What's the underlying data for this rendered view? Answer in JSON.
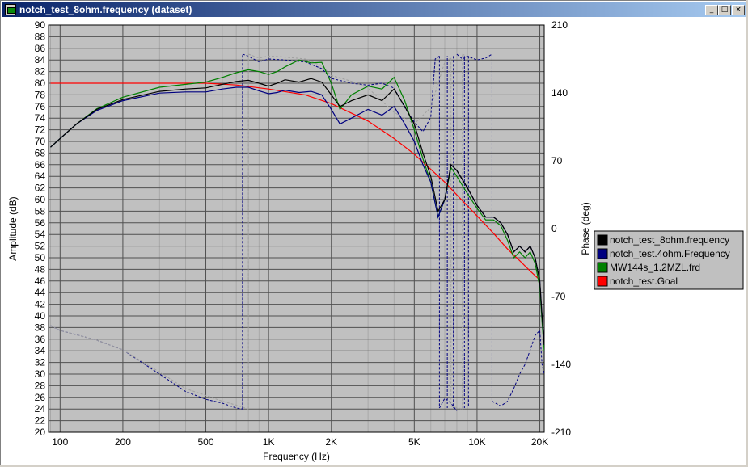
{
  "window": {
    "title": "notch_test_8ohm.frequency (dataset)",
    "controls": {
      "minimize": "_",
      "maximize": "□",
      "close": "×"
    }
  },
  "chart_data": {
    "type": "line",
    "xlabel": "Frequency (Hz)",
    "ylabel": "Amplitude (dB)",
    "y2label": "Phase (deg)",
    "xscale": "log",
    "xlim": [
      88,
      21000
    ],
    "ylim": [
      20,
      90
    ],
    "y2lim": [
      -210,
      210
    ],
    "grid": true,
    "legend_position": "right",
    "x_ticks": [
      {
        "value": 100,
        "label": "100"
      },
      {
        "value": 200,
        "label": "200"
      },
      {
        "value": 500,
        "label": "500"
      },
      {
        "value": 1000,
        "label": "1K"
      },
      {
        "value": 2000,
        "label": "2K"
      },
      {
        "value": 5000,
        "label": "5K"
      },
      {
        "value": 10000,
        "label": "10K"
      },
      {
        "value": 20000,
        "label": "20K"
      }
    ],
    "y_tick_labels": [
      "20",
      "22",
      "24",
      "26",
      "28",
      "30",
      "32",
      "34",
      "36",
      "38",
      "40",
      "42",
      "44",
      "46",
      "48",
      "50",
      "52",
      "54",
      "56",
      "58",
      "60",
      "62",
      "64",
      "66",
      "68",
      "70",
      "72",
      "74",
      "76",
      "78",
      "80",
      "82",
      "84",
      "86",
      "88",
      "90"
    ],
    "y2_ticks": [
      {
        "value": -210,
        "label": "-210"
      },
      {
        "value": -140,
        "label": "-140"
      },
      {
        "value": -70,
        "label": "-70"
      },
      {
        "value": 0,
        "label": "0"
      },
      {
        "value": 70,
        "label": "70"
      },
      {
        "value": 140,
        "label": "140"
      },
      {
        "value": 210,
        "label": "210"
      }
    ],
    "series": [
      {
        "name": "notch_test_8ohm.frequency",
        "color": "#000000",
        "axis": "amplitude",
        "points": [
          [
            90,
            69
          ],
          [
            100,
            70.5
          ],
          [
            120,
            73
          ],
          [
            150,
            75.5
          ],
          [
            200,
            77.2
          ],
          [
            300,
            78.6
          ],
          [
            400,
            79
          ],
          [
            500,
            79.2
          ],
          [
            600,
            79.8
          ],
          [
            700,
            80.3
          ],
          [
            800,
            80.5
          ],
          [
            900,
            80
          ],
          [
            1000,
            79.5
          ],
          [
            1100,
            80
          ],
          [
            1200,
            80.6
          ],
          [
            1400,
            80.2
          ],
          [
            1600,
            80.8
          ],
          [
            1800,
            80.2
          ],
          [
            2000,
            78
          ],
          [
            2200,
            76
          ],
          [
            2500,
            77
          ],
          [
            3000,
            78
          ],
          [
            3500,
            77
          ],
          [
            4000,
            79
          ],
          [
            4500,
            76
          ],
          [
            5000,
            73
          ],
          [
            5500,
            68
          ],
          [
            6000,
            64
          ],
          [
            6500,
            58
          ],
          [
            7000,
            60
          ],
          [
            7500,
            66
          ],
          [
            8000,
            65
          ],
          [
            9000,
            62
          ],
          [
            10000,
            59
          ],
          [
            11000,
            57
          ],
          [
            12000,
            57
          ],
          [
            13000,
            56
          ],
          [
            14000,
            54
          ],
          [
            15000,
            51
          ],
          [
            16000,
            52
          ],
          [
            17000,
            51
          ],
          [
            18000,
            52
          ],
          [
            19000,
            50
          ],
          [
            20000,
            46
          ],
          [
            20500,
            40
          ],
          [
            21000,
            35
          ]
        ]
      },
      {
        "name": "notch_test.4ohm.Frequency",
        "color": "#000080",
        "axis": "amplitude",
        "points": [
          [
            90,
            69
          ],
          [
            100,
            70.5
          ],
          [
            120,
            73
          ],
          [
            150,
            75.3
          ],
          [
            200,
            77
          ],
          [
            300,
            78.3
          ],
          [
            400,
            78.5
          ],
          [
            500,
            78.5
          ],
          [
            600,
            79
          ],
          [
            700,
            79.3
          ],
          [
            800,
            79.3
          ],
          [
            900,
            78.7
          ],
          [
            1000,
            78.2
          ],
          [
            1100,
            78.4
          ],
          [
            1200,
            78.8
          ],
          [
            1400,
            78.4
          ],
          [
            1600,
            78.6
          ],
          [
            1800,
            78
          ],
          [
            2000,
            75.5
          ],
          [
            2200,
            73
          ],
          [
            2500,
            74
          ],
          [
            3000,
            75.5
          ],
          [
            3500,
            74.5
          ],
          [
            4000,
            76
          ],
          [
            4500,
            73
          ],
          [
            5000,
            70
          ],
          [
            5500,
            66
          ],
          [
            6000,
            63
          ],
          [
            6500,
            57
          ],
          [
            7000,
            60
          ],
          [
            7500,
            66
          ],
          [
            8000,
            65
          ],
          [
            9000,
            62
          ],
          [
            10000,
            59
          ],
          [
            11000,
            57
          ],
          [
            12000,
            57
          ],
          [
            13000,
            56
          ],
          [
            14000,
            54
          ],
          [
            15000,
            51
          ],
          [
            16000,
            52
          ],
          [
            17000,
            51
          ],
          [
            18000,
            52
          ],
          [
            19000,
            50
          ],
          [
            20000,
            46
          ],
          [
            20500,
            40
          ],
          [
            21000,
            35
          ]
        ]
      },
      {
        "name": "MW144s_1.2MZL.frd",
        "color": "#008000",
        "axis": "amplitude",
        "points": [
          [
            90,
            69
          ],
          [
            100,
            70.5
          ],
          [
            120,
            73
          ],
          [
            150,
            75.6
          ],
          [
            200,
            77.6
          ],
          [
            300,
            79.3
          ],
          [
            400,
            79.8
          ],
          [
            500,
            80.2
          ],
          [
            600,
            81
          ],
          [
            700,
            81.8
          ],
          [
            800,
            82.3
          ],
          [
            900,
            82
          ],
          [
            1000,
            81.5
          ],
          [
            1100,
            82
          ],
          [
            1200,
            82.8
          ],
          [
            1400,
            84
          ],
          [
            1600,
            83.5
          ],
          [
            1800,
            83.6
          ],
          [
            2000,
            80
          ],
          [
            2200,
            75.5
          ],
          [
            2500,
            78
          ],
          [
            3000,
            79.5
          ],
          [
            3500,
            79
          ],
          [
            4000,
            81
          ],
          [
            4500,
            77
          ],
          [
            5000,
            72
          ],
          [
            5500,
            67
          ],
          [
            6000,
            63
          ],
          [
            6500,
            57
          ],
          [
            7000,
            60
          ],
          [
            7500,
            65.5
          ],
          [
            8000,
            64
          ],
          [
            9000,
            61
          ],
          [
            10000,
            58.5
          ],
          [
            11000,
            56.5
          ],
          [
            12000,
            56.5
          ],
          [
            13000,
            55.5
          ],
          [
            14000,
            53
          ],
          [
            15000,
            50
          ],
          [
            16000,
            51
          ],
          [
            17000,
            50
          ],
          [
            18000,
            51
          ],
          [
            19000,
            49
          ],
          [
            20000,
            45
          ],
          [
            20500,
            39
          ],
          [
            21000,
            34
          ]
        ]
      },
      {
        "name": "notch_test.Goal",
        "color": "#ff0000",
        "axis": "amplitude",
        "points": [
          [
            90,
            80
          ],
          [
            200,
            80
          ],
          [
            300,
            80
          ],
          [
            500,
            80
          ],
          [
            700,
            79.7
          ],
          [
            1000,
            79
          ],
          [
            1500,
            78
          ],
          [
            2000,
            76.5
          ],
          [
            3000,
            73.5
          ],
          [
            4000,
            70.5
          ],
          [
            5000,
            67.8
          ],
          [
            6000,
            65.2
          ],
          [
            7000,
            63
          ],
          [
            8000,
            60.8
          ],
          [
            10000,
            57.2
          ],
          [
            12000,
            54.2
          ],
          [
            14000,
            51.5
          ],
          [
            16000,
            49.5
          ],
          [
            18000,
            47.7
          ],
          [
            20000,
            46.2
          ]
        ]
      }
    ],
    "phase_series": [
      {
        "color": "#000080",
        "axis": "phase",
        "segments": [
          [
            [
              90,
              -100
            ],
            [
              100,
              -105
            ],
            [
              150,
              -115
            ],
            [
              200,
              -125
            ],
            [
              300,
              -150
            ],
            [
              400,
              -168
            ],
            [
              500,
              -176
            ],
            [
              600,
              -180
            ],
            [
              700,
              -185
            ],
            [
              750,
              -186
            ]
          ],
          [
            [
              750,
              180
            ],
            [
              800,
              178
            ],
            [
              900,
              172
            ],
            [
              1000,
              175
            ],
            [
              1200,
              174
            ],
            [
              1500,
              172
            ],
            [
              1800,
              165
            ],
            [
              2000,
              155
            ],
            [
              2500,
              150
            ],
            [
              3000,
              148
            ],
            [
              3500,
              150
            ],
            [
              4000,
              145
            ],
            [
              4500,
              125
            ],
            [
              5000,
              110
            ],
            [
              5500,
              100
            ],
            [
              6000,
              115
            ],
            [
              6300,
              175
            ],
            [
              6600,
              178
            ]
          ],
          [
            [
              6600,
              -185
            ],
            [
              7000,
              -175
            ],
            [
              7500,
              -180
            ],
            [
              8000,
              -188
            ]
          ],
          [
            [
              8000,
              180
            ],
            [
              8500,
              175
            ],
            [
              9000,
              178
            ],
            [
              10000,
              174
            ],
            [
              11000,
              176
            ],
            [
              11800,
              180
            ]
          ],
          [
            [
              11800,
              -178
            ],
            [
              13000,
              -183
            ],
            [
              14000,
              -178
            ],
            [
              15000,
              -165
            ],
            [
              16000,
              -150
            ],
            [
              17000,
              -140
            ],
            [
              18000,
              -125
            ],
            [
              19000,
              -110
            ],
            [
              20000,
              -105
            ],
            [
              20500,
              -140
            ],
            [
              21000,
              -150
            ]
          ]
        ]
      },
      {
        "color": "#a0a0a0",
        "axis": "phase",
        "segments": [
          [
            [
              90,
              -100
            ],
            [
              100,
              -105
            ],
            [
              150,
              -115
            ],
            [
              200,
              -125
            ],
            [
              300,
              -148
            ],
            [
              400,
              -165
            ],
            [
              500,
              -172
            ],
            [
              600,
              -178
            ],
            [
              700,
              -182
            ],
            [
              800,
              -186
            ]
          ],
          [
            [
              800,
              180
            ],
            [
              900,
              176
            ],
            [
              1000,
              178
            ],
            [
              1200,
              177
            ],
            [
              1500,
              175
            ],
            [
              1800,
              168
            ],
            [
              2000,
              158
            ],
            [
              2500,
              152
            ],
            [
              3000,
              145
            ],
            [
              4000,
              120
            ],
            [
              5000,
              108
            ],
            [
              6000,
              125
            ],
            [
              7000,
              172
            ],
            [
              7500,
              176
            ]
          ],
          [
            [
              7500,
              -183
            ],
            [
              8500,
              -186
            ]
          ],
          [
            [
              8500,
              180
            ],
            [
              9500,
              175
            ]
          ]
        ]
      }
    ],
    "phase_drops": [
      {
        "color": "#000080",
        "x": 750,
        "from": -186,
        "to": 180
      },
      {
        "color": "#000080",
        "x": 6600,
        "from": 178,
        "to": -185
      },
      {
        "color": "#000080",
        "x": 7200,
        "from": -185,
        "to": 178
      },
      {
        "color": "#000080",
        "x": 7700,
        "from": 178,
        "to": -185
      },
      {
        "color": "#000080",
        "x": 8700,
        "from": -185,
        "to": 178
      },
      {
        "color": "#000080",
        "x": 9100,
        "from": 178,
        "to": -183
      },
      {
        "color": "#000080",
        "x": 11800,
        "from": 180,
        "to": -178
      },
      {
        "color": "#a0a0a0",
        "x": 800,
        "from": -186,
        "to": 180
      },
      {
        "color": "#a0a0a0",
        "x": 7500,
        "from": 176,
        "to": -183
      },
      {
        "color": "#a0a0a0",
        "x": 8500,
        "from": -186,
        "to": 180
      }
    ],
    "legend": [
      {
        "label": "notch_test_8ohm.frequency",
        "color": "#000000"
      },
      {
        "label": "notch_test.4ohm.Frequency",
        "color": "#000080"
      },
      {
        "label": "MW144s_1.2MZL.frd",
        "color": "#008000"
      },
      {
        "label": "notch_test.Goal",
        "color": "#ff0000"
      }
    ]
  }
}
